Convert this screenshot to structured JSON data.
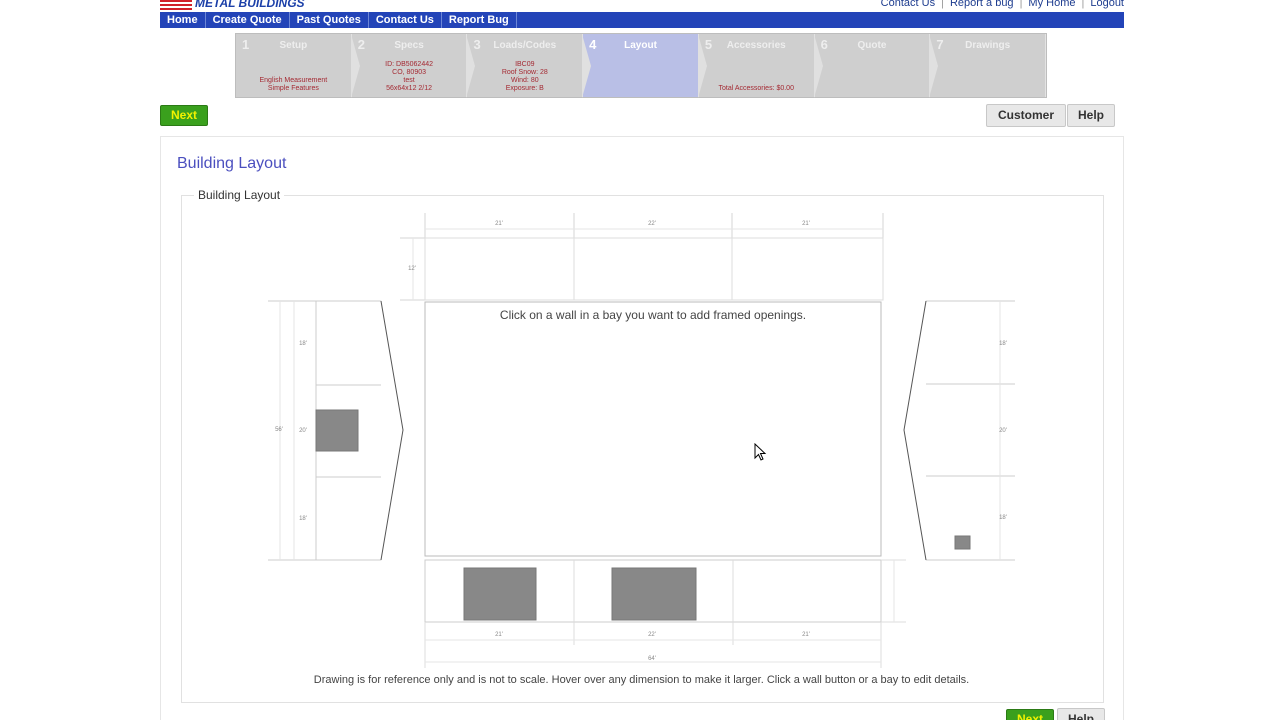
{
  "header": {
    "logo_text": "METAL BUILDINGS",
    "top_links": [
      "Contact Us",
      "Report a bug",
      "My Home",
      "Logout"
    ],
    "nav": [
      "Home",
      "Create Quote",
      "Past Quotes",
      "Contact Us",
      "Report Bug"
    ]
  },
  "steps": [
    {
      "num": "1",
      "title": "Setup",
      "detail_lines": [
        "English Measurement",
        "Simple Features"
      ]
    },
    {
      "num": "2",
      "title": "Specs",
      "detail_lines": [
        "ID: DB5062442",
        "CO, 80903",
        "test",
        "56x64x12 2/12"
      ]
    },
    {
      "num": "3",
      "title": "Loads/Codes",
      "detail_lines": [
        "IBC09",
        "Roof Snow: 28",
        "Wind: 80",
        "Exposure: B"
      ]
    },
    {
      "num": "4",
      "title": "Layout",
      "detail_lines": []
    },
    {
      "num": "5",
      "title": "Accessories",
      "detail_lines": [
        "Total Accessories: $0.00"
      ]
    },
    {
      "num": "6",
      "title": "Quote",
      "detail_lines": []
    },
    {
      "num": "7",
      "title": "Drawings",
      "detail_lines": []
    }
  ],
  "buttons": {
    "next": "Next",
    "customer": "Customer",
    "help": "Help"
  },
  "panel": {
    "title": "Building Layout",
    "legend": "Building Layout",
    "hint": "Click on a wall in a bay you want to add framed openings.",
    "note": "Drawing is for reference only and is not to scale. Hover over any dimension to make it larger. Click a wall button or a bay to edit details."
  },
  "dimensions": {
    "top_bays": [
      "21'",
      "22'",
      "21'"
    ],
    "top_height": "12'",
    "left_bays": [
      "18'",
      "20'",
      "18'"
    ],
    "left_total": "56'",
    "right_bays": [
      "18'",
      "20'",
      "18'"
    ],
    "bottom_bays": [
      "21'",
      "22'",
      "21'"
    ],
    "bottom_total": "64'"
  },
  "colors": {
    "nav_blue": "#2344b8",
    "active_step": "#b9bfe6",
    "next_green": "#3aa01d",
    "title_purple": "#4b4fbf",
    "opening_gray": "#888888"
  }
}
